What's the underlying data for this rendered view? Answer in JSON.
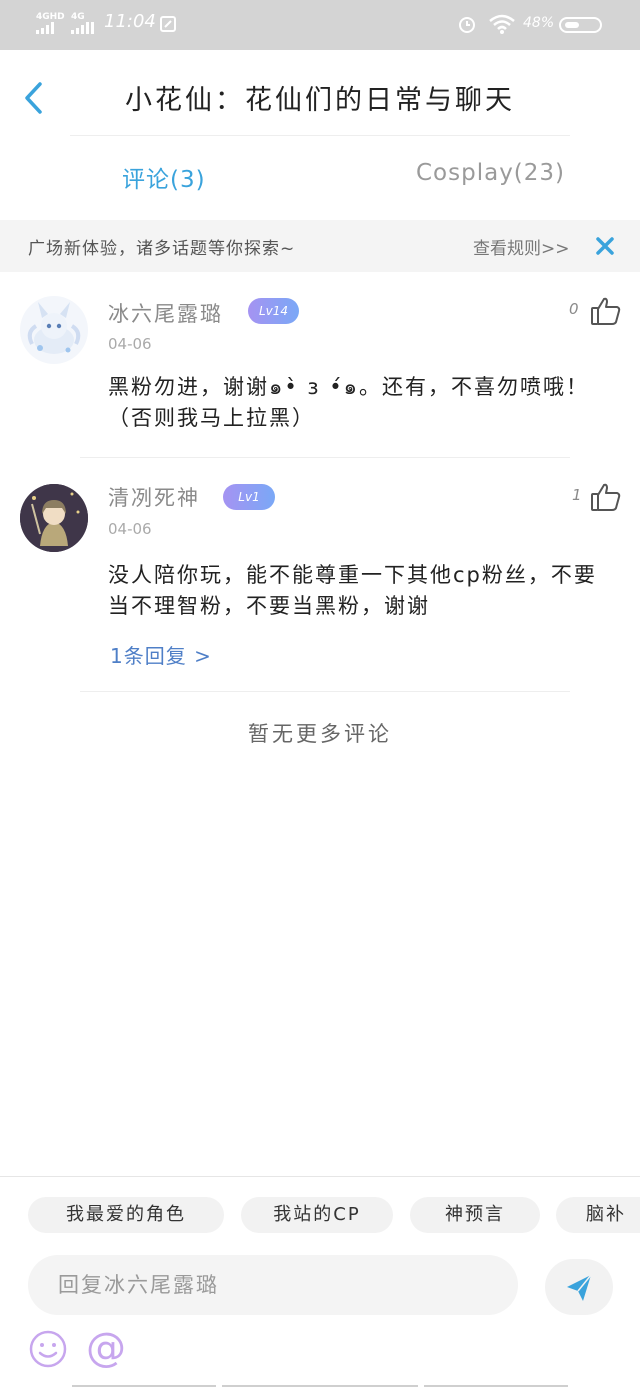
{
  "status_bar": {
    "net1": "4GHD",
    "net2": "4G",
    "time": "11:04",
    "battery": "48%"
  },
  "header": {
    "title": "小花仙：花仙们的日常与聊天"
  },
  "tabs": [
    {
      "label": "评论(3)",
      "active": true
    },
    {
      "label": "Cosplay(23)",
      "active": false
    }
  ],
  "notice": {
    "text": "广场新体验，诸多话题等你探索~",
    "rules_link": "查看规则>>"
  },
  "comments": [
    {
      "user": "冰六尾露璐",
      "level": "Lv14",
      "date": "04-06",
      "likes": "0",
      "text": "黑粉勿进，谢谢๑•̀ з •́๑。还有，不喜勿喷哦！（否则我马上拉黑）"
    },
    {
      "user": "清冽死神",
      "level": "Lv1",
      "date": "04-06",
      "likes": "1",
      "text": "没人陪你玩，能不能尊重一下其他cp粉丝，不要当不理智粉，不要当黑粉，谢谢",
      "replies": "1条回复 >"
    }
  ],
  "no_more": "暂无更多评论",
  "composer": {
    "topics": [
      "我最爱的角色",
      "我站的CP",
      "神预言",
      "脑补"
    ],
    "placeholder": "回复冰六尾露璐",
    "at_symbol": "@"
  },
  "colors": {
    "accent_blue": "#3aa3dc",
    "level_badge": "#9b98f4",
    "reply_link": "#4f7fc7"
  }
}
